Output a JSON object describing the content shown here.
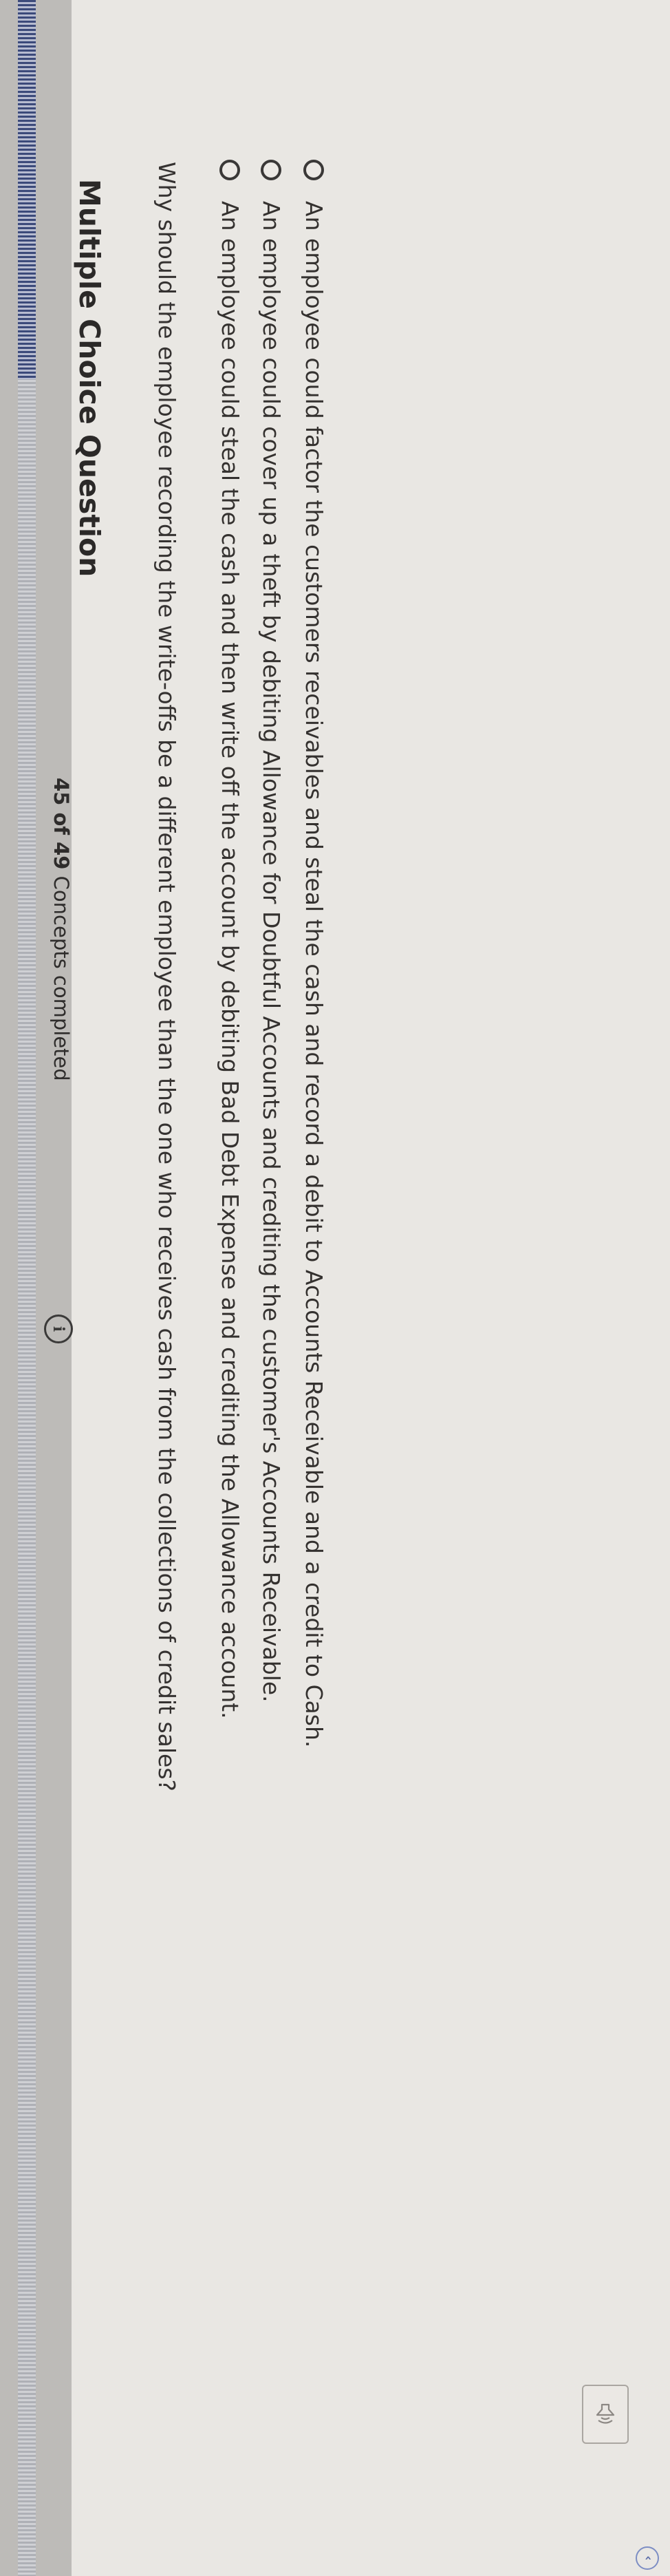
{
  "progress": {
    "label_count": "45 of 49",
    "label_rest": " Concepts completed",
    "completed": 45,
    "total": 49
  },
  "info_glyph": "i",
  "question_type": "Multiple Choice Question",
  "question_text": "Why should the employee recording the write-offs be a different employee than the one who receives cash from the collections of credit sales?",
  "options": [
    "An employee could steal the cash and then write off the account by debiting Bad Debt Expense and crediting the Allowance account.",
    "An employee could cover up a theft by debiting Allowance for Doubtful Accounts and crediting the customer's Accounts Receivable.",
    "An employee could factor the customers receivables and steal the cash and record a debit to Accounts Receivable and a credit to Cash."
  ],
  "corner_glyph": "‹",
  "icons": {
    "info": "info-icon",
    "audio": "speaker-icon",
    "corner": "chevron-left-icon"
  },
  "colors": {
    "progress_fill": "#3c4a7a",
    "progress_track": "#aeb0b6",
    "background": "#e9e7e3",
    "text": "#2f2d2c"
  }
}
